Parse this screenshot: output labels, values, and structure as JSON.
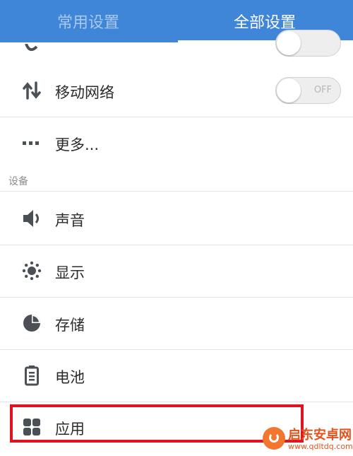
{
  "tabs": {
    "common": "常用设置",
    "all": "全部设置"
  },
  "rows": {
    "mobile_network": {
      "label": "移动网络",
      "toggle_state": "OFF"
    },
    "more": {
      "label": "更多..."
    },
    "sound": {
      "label": "声音"
    },
    "display": {
      "label": "显示"
    },
    "storage": {
      "label": "存储"
    },
    "battery": {
      "label": "电池"
    },
    "apps": {
      "label": "应用"
    }
  },
  "section": {
    "device": "设备"
  },
  "watermark": {
    "title": "启东安卓网",
    "url": "www.qdltdq.com"
  },
  "colors": {
    "tabbar": "#3f86d8",
    "highlight": "#e0141e",
    "icon": "#4b5056"
  }
}
